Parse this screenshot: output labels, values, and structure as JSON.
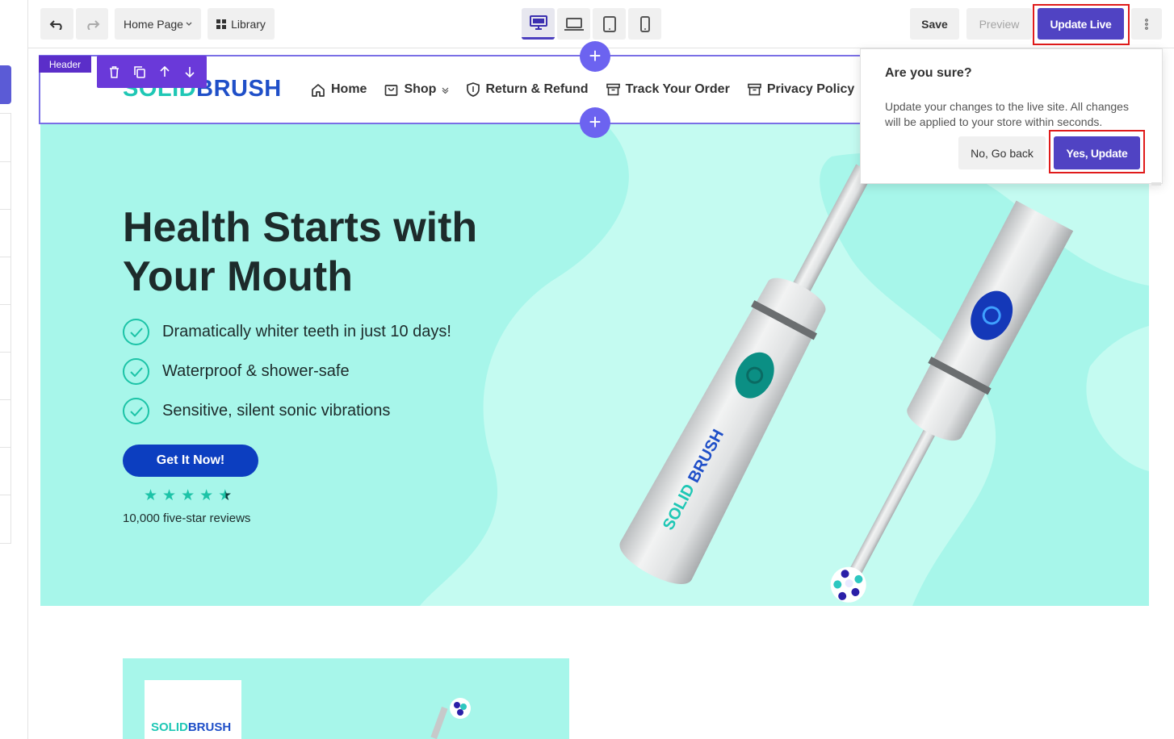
{
  "toolbar": {
    "undo_icon": "undo-icon",
    "redo_icon": "redo-icon",
    "page_select": "Home Page",
    "library_label": "Library",
    "devices": [
      "desktop",
      "laptop",
      "tablet",
      "mobile"
    ],
    "active_device": "desktop",
    "save_label": "Save",
    "preview_label": "Preview",
    "update_live_label": "Update Live",
    "more_icon": "more-vertical-icon"
  },
  "editor": {
    "header_tag": "Header",
    "section_tools": [
      "trash-icon",
      "copy-icon",
      "arrow-up-icon",
      "arrow-down-icon"
    ],
    "add_section_icon": "plus-icon"
  },
  "site": {
    "logo_part1": "SOLID",
    "logo_part2": "BRUSH",
    "nav": [
      {
        "label": "Home",
        "icon": "home-icon"
      },
      {
        "label": "Shop",
        "icon": "bag-icon",
        "dropdown": true
      },
      {
        "label": "Return & Refund",
        "icon": "shield-icon"
      },
      {
        "label": "Track Your Order",
        "icon": "box-icon"
      },
      {
        "label": "Privacy Policy",
        "icon": "box-icon"
      }
    ],
    "hero": {
      "title_line1": "Health Starts with",
      "title_line2": "Your Mouth",
      "features": [
        "Dramatically whiter teeth in just 10 days!",
        "Waterproof & shower-safe",
        "Sensitive, silent sonic vibrations"
      ],
      "cta_label": "Get It Now!",
      "rating": 4.5,
      "reviews_label": "10,000 five-star reviews"
    },
    "product_logo_part1": "SOLID",
    "product_logo_part2": "BRUSH"
  },
  "confirm": {
    "title": "Are you sure?",
    "message": "Update your changes to the live site. All changes will be applied to your store within seconds.",
    "no_label": "No, Go back",
    "yes_label": "Yes, Update"
  },
  "colors": {
    "accent": "#5043c3",
    "hero_bg": "#a7f6ea",
    "teal": "#1cc3a7",
    "cta": "#0c3ec0",
    "highlight": "#e01b1b"
  }
}
